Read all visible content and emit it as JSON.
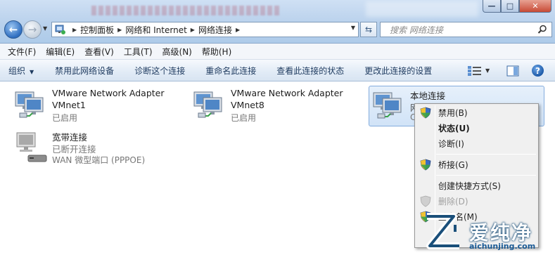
{
  "window": {
    "controls": {
      "minimize": "—",
      "maximize": "□",
      "close": "✕"
    }
  },
  "nav": {
    "back_icon": "back-arrow",
    "forward_icon": "forward-arrow"
  },
  "address": {
    "crumbs": [
      "控制面板",
      "网络和 Internet",
      "网络连接"
    ],
    "separator": "▶"
  },
  "search": {
    "placeholder": "搜索 网络连接"
  },
  "menubar": {
    "items": [
      "文件(F)",
      "编辑(E)",
      "查看(V)",
      "工具(T)",
      "高级(N)",
      "帮助(H)"
    ]
  },
  "commandbar": {
    "organize": "组织",
    "items": [
      "禁用此网络设备",
      "诊断这个连接",
      "重命名此连接",
      "查看此连接的状态",
      "更改此连接的设置"
    ],
    "help": "?"
  },
  "connections": [
    {
      "name": "VMware Network Adapter",
      "line2": "VMnet1",
      "status": "已启用",
      "icon": "network-adapter-icon"
    },
    {
      "name": "VMware Network Adapter",
      "line2": "VMnet8",
      "status": "已启用",
      "icon": "network-adapter-icon"
    },
    {
      "name": "本地连接",
      "line2": "网",
      "status": "C",
      "icon": "network-adapter-icon",
      "selected": true
    },
    {
      "name": "宽带连接",
      "line2": "已断开连接",
      "status": "WAN 微型端口 (PPPOE)",
      "icon": "broadband-icon"
    }
  ],
  "context_menu": {
    "items": [
      "禁用(B)",
      "状态(U)",
      "诊断(I)",
      "桥接(G)",
      "创建快捷方式(S)",
      "删除(D)",
      "重命名(M)"
    ]
  },
  "watermark": {
    "text": "爱纯净",
    "url": "aichunjing.com"
  },
  "colors": {
    "accent": "#1d5aa8",
    "selection": "#d1e3f7",
    "watermark": "#1a5a95"
  }
}
